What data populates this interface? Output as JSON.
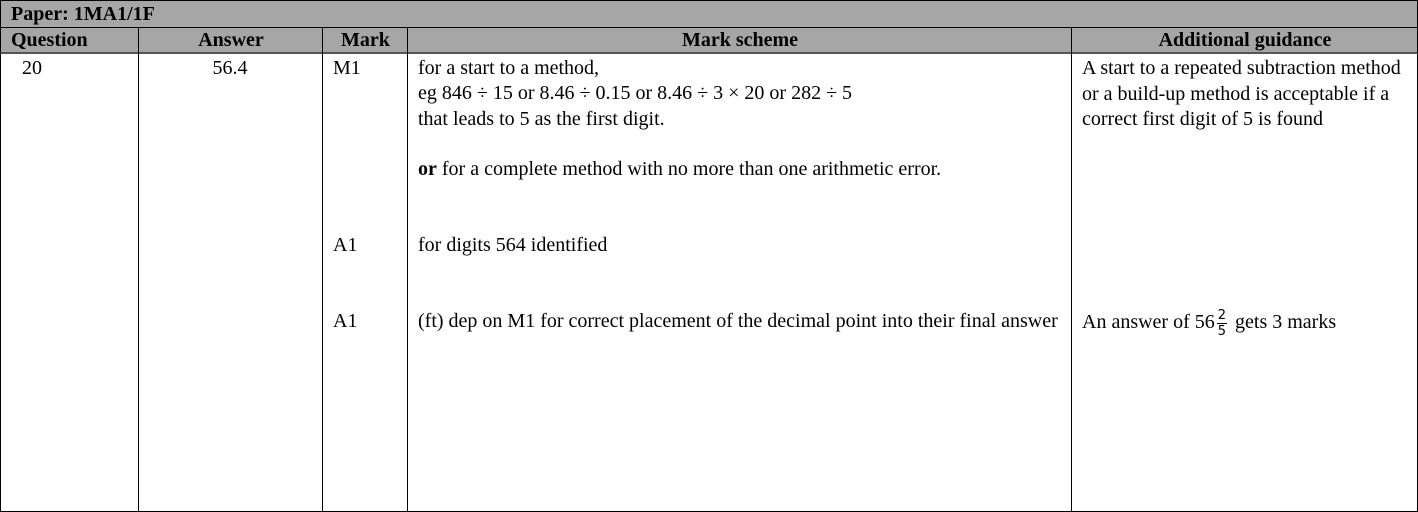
{
  "paper_title": "Paper: 1MA1/1F",
  "headers": {
    "question": "Question",
    "answer": "Answer",
    "mark": "Mark",
    "mark_scheme": "Mark scheme",
    "guidance": "Additional guidance"
  },
  "row": {
    "question": "20",
    "answer": "56.4",
    "entries": [
      {
        "mark": "M1",
        "scheme_line1": "for a start to a method,",
        "scheme_line2": "eg 846 ÷ 15 or 8.46 ÷ 0.15 or 8.46 ÷ 3 × 20 or 282 ÷ 5",
        "scheme_line3": "that leads to 5 as the first digit.",
        "scheme_or": "or",
        "scheme_or_rest": " for a complete method with no more than one arithmetic error.",
        "guidance": "A start to a repeated subtraction method or a build-up method is acceptable if a correct first digit of 5 is found"
      },
      {
        "mark": "A1",
        "scheme": "for digits 564 identified"
      },
      {
        "mark": "A1",
        "scheme": "(ft) dep on M1 for correct placement of the decimal point into their final answer",
        "guidance_prefix": "An answer of 56",
        "guidance_frac_num": "2",
        "guidance_frac_den": "5",
        "guidance_suffix": " gets 3 marks"
      }
    ]
  }
}
